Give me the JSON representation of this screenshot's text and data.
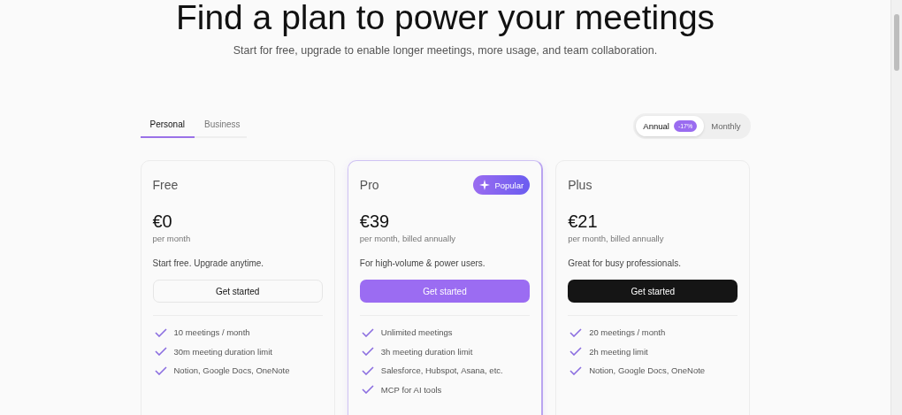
{
  "heading": "Find a plan to power your meetings",
  "subheading": "Start for free, upgrade to enable longer meetings, more usage, and team collaboration.",
  "tabs": [
    {
      "label": "Personal",
      "selected": true
    },
    {
      "label": "Business",
      "selected": false
    }
  ],
  "billing_toggle": [
    {
      "label": "Annual",
      "selected": true,
      "badge": "-17%"
    },
    {
      "label": "Monthly",
      "selected": false
    }
  ],
  "plans": [
    {
      "name": "Free",
      "price": "€0",
      "period": "per month",
      "description": "Start free. Upgrade anytime.",
      "button": {
        "label": "Get started",
        "kind": "outline"
      },
      "features": [
        "10 meetings / month",
        "30m meeting duration limit",
        "Notion, Google Docs, OneNote"
      ]
    },
    {
      "name": "Pro",
      "badge": "Popular",
      "highlighted": true,
      "price": "€39",
      "period": "per month, billed annually",
      "description": "For high-volume & power users.",
      "button": {
        "label": "Get started",
        "kind": "primary"
      },
      "features": [
        "Unlimited meetings",
        "3h meeting duration limit",
        "Salesforce, Hubspot, Asana, etc.",
        "MCP for AI tools"
      ]
    },
    {
      "name": "Plus",
      "price": "€21",
      "period": "per month, billed annually",
      "description": "Great for busy professionals.",
      "button": {
        "label": "Get started",
        "kind": "dark"
      },
      "features": [
        "20 meetings / month",
        "2h meeting limit",
        "Notion, Google Docs, OneNote"
      ]
    }
  ]
}
